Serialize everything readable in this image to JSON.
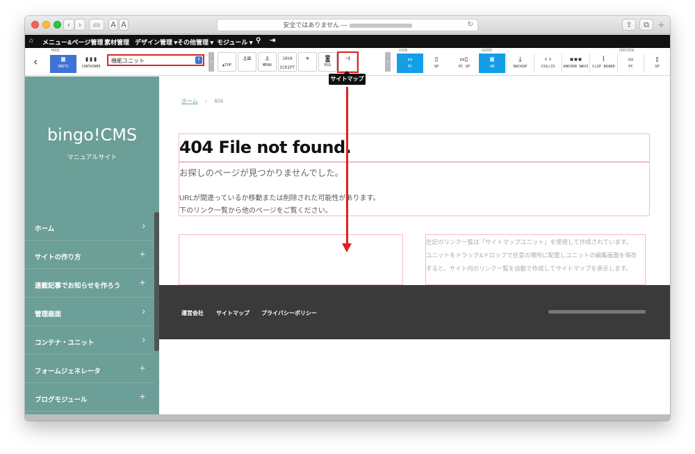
{
  "browser": {
    "address": "安全ではありません —",
    "font_small": "A",
    "font_large": "A"
  },
  "menubar": {
    "items": [
      "メニュー&ページ管理",
      "素材管理",
      "デザイン管理 ▾",
      "その他管理 ▾",
      "モジュール ▾"
    ]
  },
  "toolbar": {
    "mode_label": "MODE",
    "modes": [
      "UNITS",
      "CONTAINER"
    ],
    "unit_select": "機能ユニット",
    "tools": [
      "▲TOP",
      "",
      "MENU",
      "JAVA SCRIPT",
      "",
      "RSS",
      ""
    ],
    "view_label": "VIEW",
    "views": [
      "PC",
      "SP",
      "PC SP"
    ],
    "guide_label": "GUIDE",
    "guide": "ON",
    "actions": [
      "BACKUP",
      "CSS/JS",
      "ANCHOR NAVI",
      "CLIP BOARD"
    ],
    "preview_label": "PREVIEW",
    "previews": [
      "PC",
      "SP"
    ],
    "tooltip": "サイトマップ"
  },
  "sidebar": {
    "brand": "bingo!CMS",
    "subtitle": "マニュアルサイト",
    "items": [
      {
        "label": "ホーム",
        "mark": "›"
      },
      {
        "label": "サイトの作り方",
        "mark": "+"
      },
      {
        "label": "連載記事でお知らせを作ろう",
        "mark": "+"
      },
      {
        "label": "管理画面",
        "mark": "›"
      },
      {
        "label": "コンテナ・ユニット",
        "mark": "›"
      },
      {
        "label": "フォームジェネレータ",
        "mark": "+"
      },
      {
        "label": "ブログモジュール",
        "mark": "+"
      }
    ]
  },
  "content": {
    "breadcrumb_home": "ホーム",
    "breadcrumb_sep": "›",
    "breadcrumb_current": "404",
    "title": "404 File not found.",
    "lead": "お探しのページが見つかりませんでした。",
    "body_line1": "URLが間違っているか移動または削除された可能性があります。",
    "body_line2": "下のリンク一覧から他のページをご覧ください。",
    "note_line1": "左記のリンク一覧は「サイトマップユニット」を使用して作成されています。",
    "note_line2": "ユニットをドラッグ&ドロップで任意の場所に配置しユニットの編集画面を保存",
    "note_line3": "すると、サイト内のリンク一覧を自動で作成してサイトマップを表示します。"
  },
  "footer": {
    "links": [
      "運営会社",
      "サイトマップ",
      "プライバシーポリシー"
    ]
  },
  "colors": {
    "sidebar": "#6c9f97",
    "accent_blue": "#139ee8",
    "highlight_red": "#e02020",
    "footer": "#3a3a3a"
  }
}
